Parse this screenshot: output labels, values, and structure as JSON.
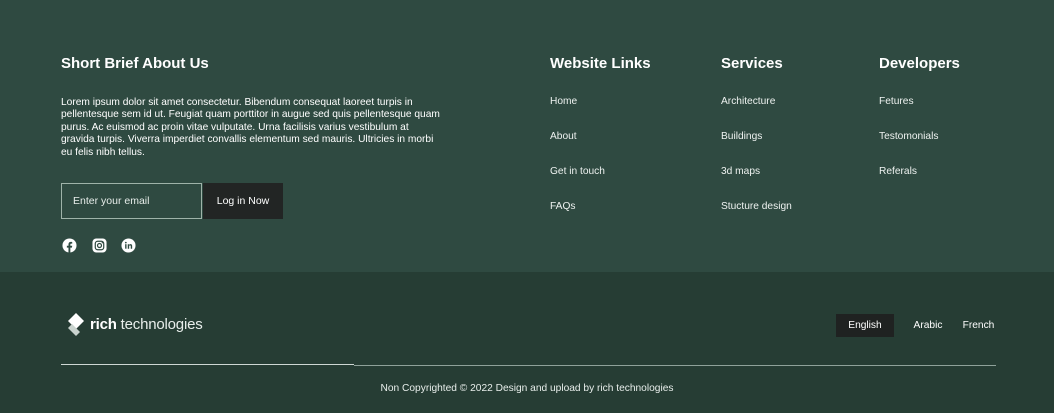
{
  "about": {
    "title": "Short Brief About Us",
    "text": "Lorem ipsum dolor sit amet consectetur. Bibendum consequat laoreet turpis in pellentesque sem id ut. Feugiat quam porttitor in augue sed quis pellentesque quam purus. Ac euismod ac proin vitae vulputate. Urna facilisis varius vestibulum at gravida turpis. Viverra imperdiet convallis elementum sed mauris. Ultricies in morbi eu felis nibh tellus.",
    "email_placeholder": "Enter your email",
    "login_label": "Log in Now",
    "social_icons": [
      "facebook-icon",
      "instagram-icon",
      "linkedin-icon"
    ]
  },
  "website_links": {
    "title": "Website Links",
    "items": [
      "Home",
      "About",
      "Get in touch",
      "FAQs"
    ]
  },
  "services": {
    "title": "Services",
    "items": [
      "Architecture",
      "Buildings",
      "3d maps",
      "Stucture design"
    ]
  },
  "developers": {
    "title": "Developers",
    "items": [
      "Fetures",
      "Testomonials",
      "Referals"
    ]
  },
  "brand": {
    "bold": "rich",
    "light": " technologies"
  },
  "languages": {
    "items": [
      "English",
      "Arabic",
      "French"
    ],
    "selected": "English"
  },
  "copyright": "Non Copyrighted © 2022 Design and upload by rich technologies",
  "colors": {
    "top_background": "#2f4a41",
    "bottom_background": "#263d34",
    "button_dark": "#222524"
  }
}
